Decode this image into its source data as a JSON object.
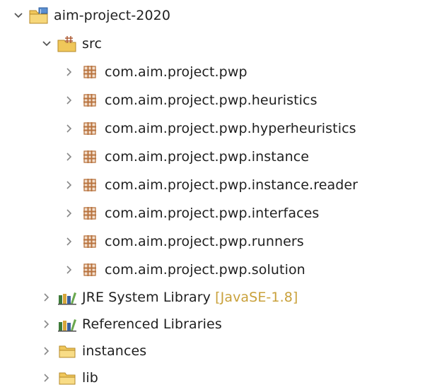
{
  "tree": {
    "project": {
      "label": "aim-project-2020",
      "expanded": true
    },
    "src": {
      "label": "src",
      "expanded": true
    },
    "packages": [
      {
        "label": "com.aim.project.pwp"
      },
      {
        "label": "com.aim.project.pwp.heuristics"
      },
      {
        "label": "com.aim.project.pwp.hyperheuristics"
      },
      {
        "label": "com.aim.project.pwp.instance"
      },
      {
        "label": "com.aim.project.pwp.instance.reader"
      },
      {
        "label": "com.aim.project.pwp.interfaces"
      },
      {
        "label": "com.aim.project.pwp.runners"
      },
      {
        "label": "com.aim.project.pwp.solution"
      }
    ],
    "jre": {
      "label": "JRE System Library",
      "decoration": "[JavaSE-1.8]"
    },
    "referenced": {
      "label": "Referenced Libraries"
    },
    "instances": {
      "label": "instances"
    },
    "lib": {
      "label": "lib"
    }
  },
  "icons": {
    "chevron_collapsed": "chevron-right-icon",
    "chevron_expanded": "chevron-down-icon",
    "project": "java-project-icon",
    "source_folder": "source-folder-icon",
    "package": "package-icon",
    "library": "library-icon",
    "folder": "folder-icon"
  },
  "colors": {
    "text": "#1f1f1f",
    "decoration": "#c9a13b",
    "chevron": "#7a7a7a",
    "folder": "#e8b84a",
    "package": "#b8733f"
  }
}
